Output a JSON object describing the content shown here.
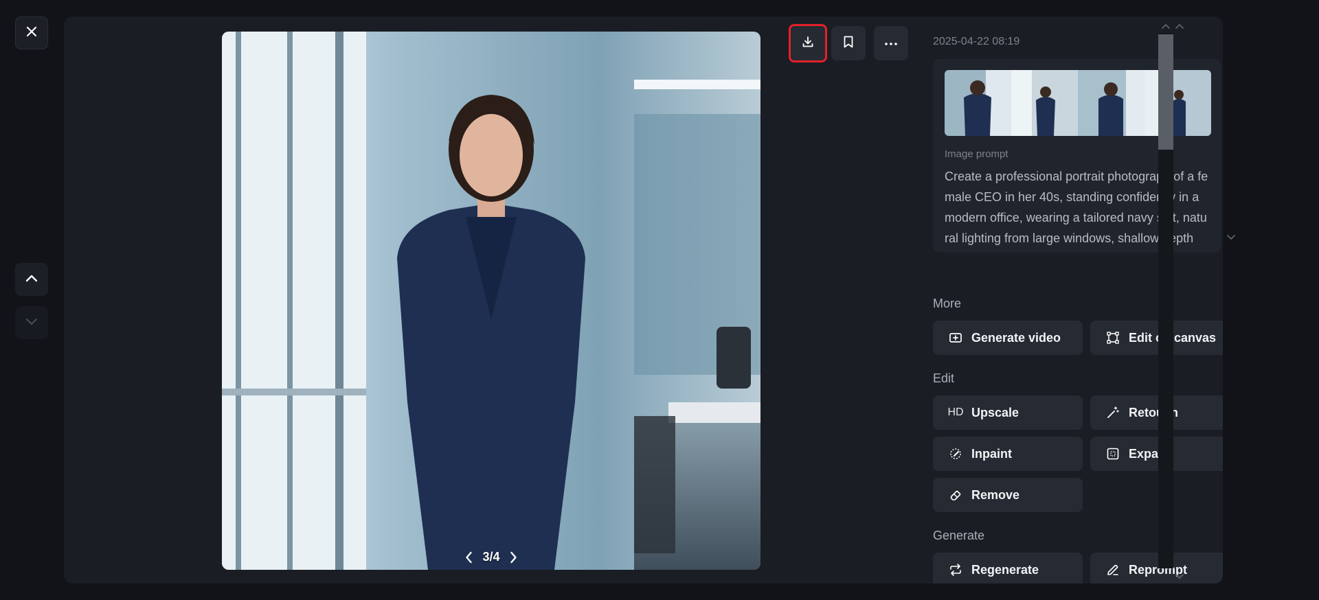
{
  "window": {
    "close_icon": "close-icon"
  },
  "nav": {
    "up_icon": "chevron-up-icon",
    "down_icon": "chevron-down-icon"
  },
  "viewer": {
    "pager_text": "3/4",
    "prev_icon": "chevron-left-icon",
    "next_icon": "chevron-right-icon"
  },
  "actions": {
    "download_icon": "download-icon",
    "bookmark_icon": "bookmark-icon",
    "more_icon": "more-horizontal-icon",
    "highlight_color": "#e3202a"
  },
  "details": {
    "timestamp": "2025-04-22 08:19",
    "prompt_label": "Image prompt",
    "prompt_text": "Create a professional portrait photograph of a female CEO in her 40s, standing confidently in a modern office, wearing a tailored navy suit, natural lighting from large windows, shallow depth"
  },
  "sections": {
    "more": {
      "label": "More",
      "items": [
        {
          "label": "Generate video",
          "icon": "video-plus-icon"
        },
        {
          "label": "Edit on canvas",
          "icon": "canvas-icon"
        }
      ]
    },
    "edit": {
      "label": "Edit",
      "items": [
        {
          "label": "Upscale",
          "icon": "HD"
        },
        {
          "label": "Retouch",
          "icon": "magic-wand-icon"
        },
        {
          "label": "Inpaint",
          "icon": "brush-icon"
        },
        {
          "label": "Expand",
          "icon": "expand-icon"
        },
        {
          "label": "Remove",
          "icon": "eraser-icon"
        }
      ]
    },
    "generate": {
      "label": "Generate",
      "items": [
        {
          "label": "Regenerate",
          "icon": "repeat-icon"
        },
        {
          "label": "Reprompt",
          "icon": "pencil-icon"
        }
      ]
    }
  }
}
